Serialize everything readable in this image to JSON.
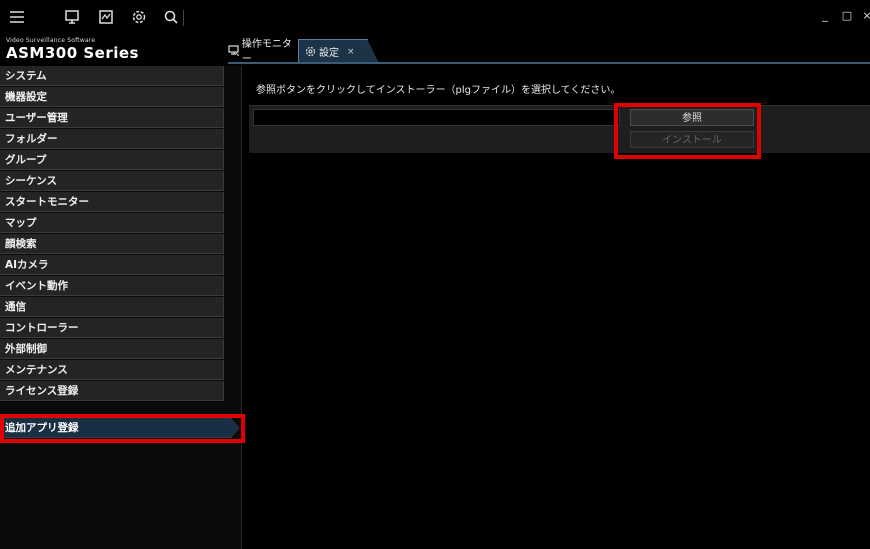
{
  "toolbar": {
    "icons": [
      "menu-icon",
      "monitor-icon",
      "map-icon",
      "settings-icon",
      "search-icon"
    ],
    "window_controls": {
      "minimize": "_",
      "maximize": "□",
      "close": "×"
    }
  },
  "brand": {
    "subtitle": "Video Surveillance Software",
    "title": "ASM300 Series"
  },
  "tabs": [
    {
      "label": "操作モニター",
      "icon": "monitor-icon"
    },
    {
      "label": "設定",
      "icon": "settings-icon",
      "close": "×",
      "active": true
    }
  ],
  "sidebar": {
    "items": [
      {
        "label": "システム"
      },
      {
        "label": "機器設定"
      },
      {
        "label": "ユーザー管理"
      },
      {
        "label": "フォルダー"
      },
      {
        "label": "グループ"
      },
      {
        "label": "シーケンス"
      },
      {
        "label": "スタートモニター"
      },
      {
        "label": "マップ"
      },
      {
        "label": "顔検索"
      },
      {
        "label": "AIカメラ"
      },
      {
        "label": "イベント動作"
      },
      {
        "label": "通信"
      },
      {
        "label": "コントローラー"
      },
      {
        "label": "外部制御"
      },
      {
        "label": "メンテナンス"
      },
      {
        "label": "ライセンス登録"
      },
      {
        "label": "追加アプリ登録",
        "active": true
      }
    ]
  },
  "main": {
    "instruction": "参照ボタンをクリックしてインストーラー（plgファイル）を選択してください。",
    "file_path_value": "",
    "browse_label": "参照",
    "install_label": "インストール"
  },
  "colors": {
    "highlight": "#e10000",
    "active_tab": "#1d3448",
    "active_item": "#1a2f44"
  }
}
